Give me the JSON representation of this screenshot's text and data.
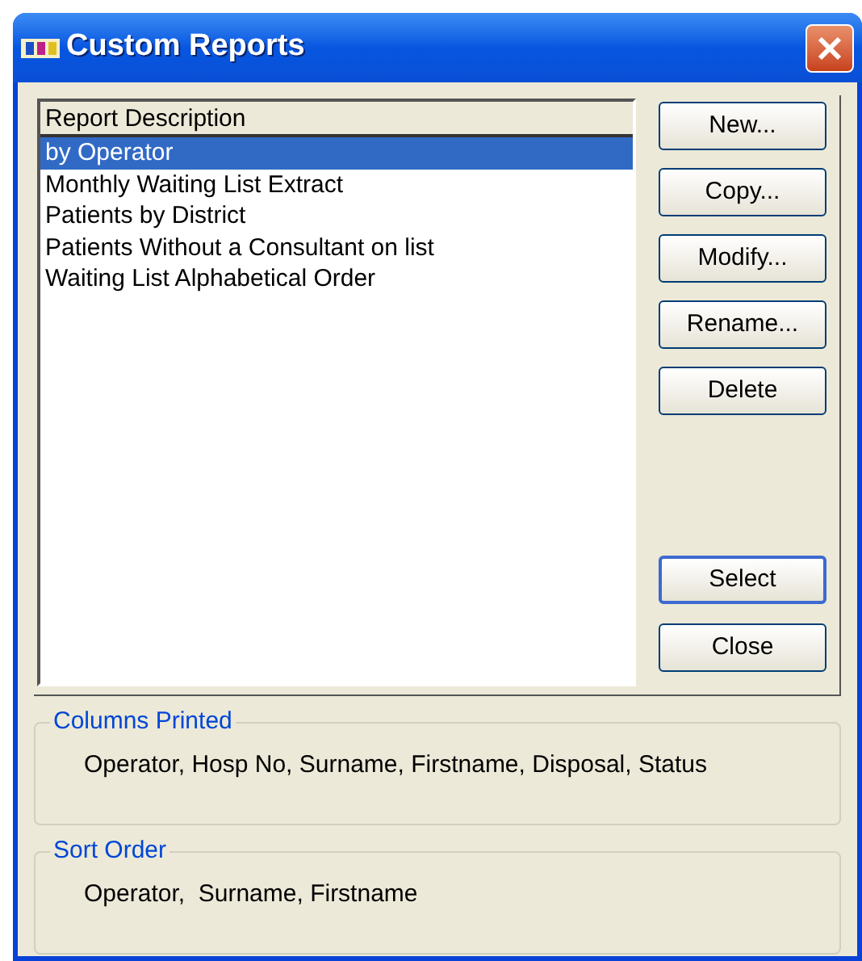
{
  "window": {
    "title": "Custom Reports"
  },
  "list": {
    "header": "Report Description",
    "items": [
      {
        "label": "by Operator",
        "selected": true
      },
      {
        "label": "Monthly Waiting List Extract",
        "selected": false
      },
      {
        "label": "Patients by District",
        "selected": false
      },
      {
        "label": "Patients Without a Consultant on list",
        "selected": false
      },
      {
        "label": "Waiting List Alphabetical Order",
        "selected": false
      }
    ]
  },
  "buttons_top": [
    {
      "label": "New...",
      "default": false
    },
    {
      "label": "Copy...",
      "default": false
    },
    {
      "label": "Modify...",
      "default": false
    },
    {
      "label": "Rename...",
      "default": false
    },
    {
      "label": "Delete",
      "default": false
    }
  ],
  "buttons_bottom": [
    {
      "label": "Select",
      "default": true
    },
    {
      "label": "Close",
      "default": false
    }
  ],
  "groups": [
    {
      "title": "Columns Printed",
      "text": "Operator, Hosp No, Surname, Firstname, Disposal, Status"
    },
    {
      "title": "Sort Order",
      "text": "Operator,  Surname, Firstname"
    }
  ]
}
